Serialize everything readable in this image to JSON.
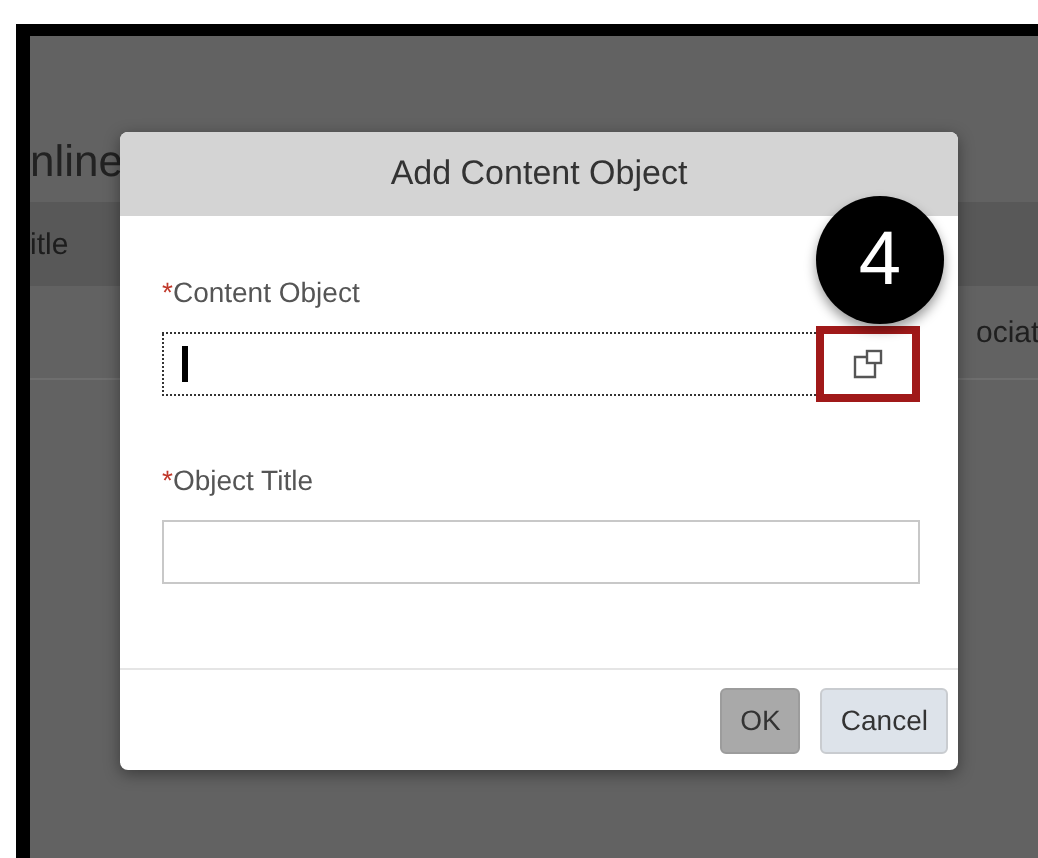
{
  "background": {
    "heading": "nline",
    "column_header": "itle",
    "cell": "ociat"
  },
  "dialog": {
    "title": "Add Content Object",
    "fields": [
      {
        "label": "Content Object",
        "required_mark": "*",
        "focused": true,
        "value_help": {
          "highlighted": true
        }
      },
      {
        "label": "Object Title",
        "required_mark": "*",
        "focused": false
      }
    ],
    "buttons": [
      {
        "label": "OK",
        "kind": "primary"
      },
      {
        "label": "Cancel",
        "kind": "secondary"
      }
    ]
  },
  "step_badge": "4"
}
